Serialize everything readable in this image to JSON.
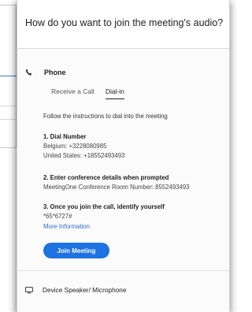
{
  "dialog": {
    "title": "How do you want to join the meeting's audio?"
  },
  "phone": {
    "label": "Phone",
    "icon": "phone-icon",
    "tabs": [
      {
        "label": "Receive a Call",
        "active": false
      },
      {
        "label": "Dial-in",
        "active": true
      }
    ],
    "instructions": "Follow the instructions to dial into the meeting",
    "steps": [
      {
        "title": "1. Dial Number",
        "lines": [
          "Belgium: +3228080985",
          "United States: +18552493493"
        ]
      },
      {
        "title": "2. Enter conference details when prompted",
        "lines": [
          "MeetingOne Conference Room Number: 8552493493"
        ]
      },
      {
        "title": "3. Once you join the call, identify yourself",
        "lines": [
          "*65*6727#"
        ]
      }
    ],
    "more_info_link": "More Information",
    "join_button": "Join Meeting"
  },
  "speaker": {
    "label": "Device Speaker/ Microphone",
    "icon": "monitor-icon"
  },
  "colors": {
    "accent": "#1d73e2",
    "link": "#2a6ccf"
  }
}
